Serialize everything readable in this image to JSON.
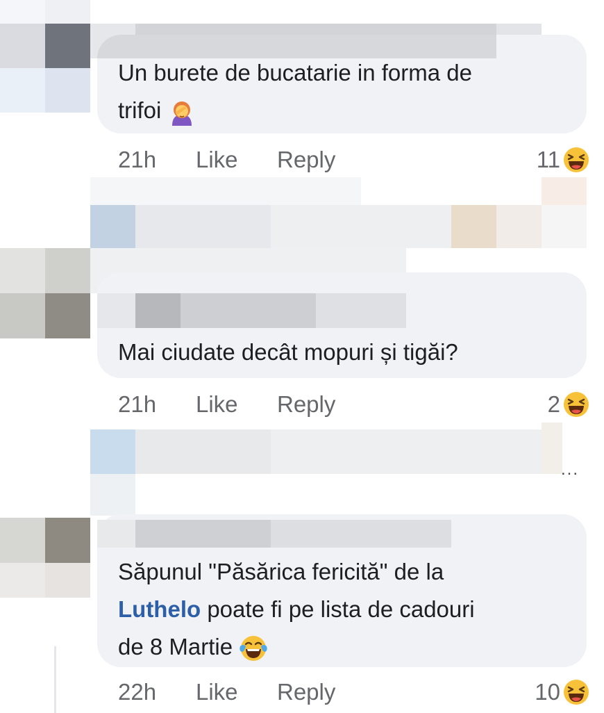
{
  "comments": [
    {
      "text": "Un burete de bucatarie in forma de trifoi",
      "text_line1": "Un burete de bucatarie in forma de",
      "text_line2": "trifoi",
      "emoji": "person-facepalming",
      "time": "21h",
      "like_label": "Like",
      "reply_label": "Reply",
      "reaction_count": "11",
      "reaction_icon": "laughing-squinting-face"
    },
    {
      "text": "Mai ciudate decât mopuri și tigăi?",
      "time": "21h",
      "like_label": "Like",
      "reply_label": "Reply",
      "reaction_count": "2",
      "reaction_icon": "laughing-squinting-face"
    },
    {
      "text_line1": "Săpunul \"Păsărica fericită\" de la",
      "mention": "Luthelo",
      "text_line2_rest": " poate fi pe lista de cadouri",
      "text_line3": "de 8 Martie",
      "emoji": "face-with-tears-of-joy",
      "time": "22h",
      "like_label": "Like",
      "reply_label": "Reply",
      "reaction_count": "10",
      "reaction_icon": "laughing-squinting-face"
    }
  ],
  "more_menu": "...",
  "colors": {
    "bubble": "#f0f2f5",
    "meta": "#65676b",
    "mention": "#2d5fa8",
    "text": "#1c1e21"
  }
}
